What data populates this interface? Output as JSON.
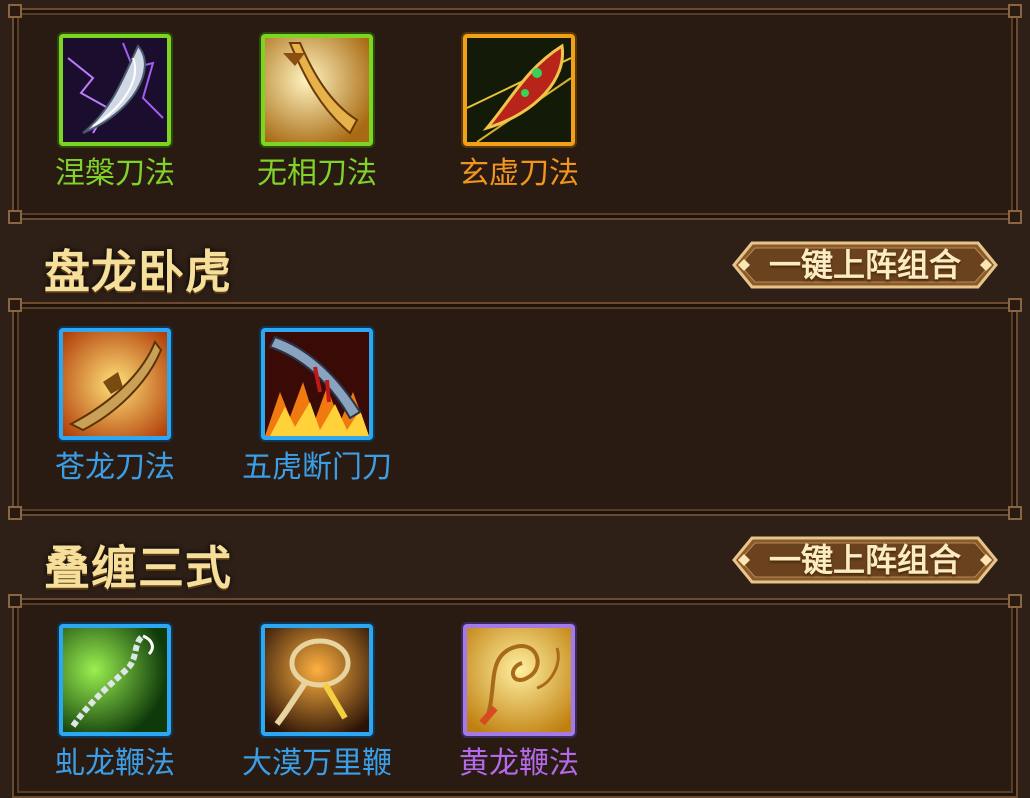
{
  "groups": [
    {
      "skills": [
        {
          "name": "涅槃刀法",
          "rarity": "green",
          "icon": "purple-lightning-blade-icon"
        },
        {
          "name": "无相刀法",
          "rarity": "green",
          "icon": "golden-sabre-icon"
        },
        {
          "name": "玄虚刀法",
          "rarity": "orange",
          "icon": "ornate-red-blade-icon"
        }
      ]
    },
    {
      "title": "盘龙卧虎",
      "deploy_label": "一键上阵组合",
      "skills": [
        {
          "name": "苍龙刀法",
          "rarity": "blue",
          "icon": "flaming-dragon-blade-icon"
        },
        {
          "name": "五虎断门刀",
          "rarity": "blue",
          "icon": "bloody-fire-blade-icon"
        }
      ]
    },
    {
      "title": "叠缠三式",
      "deploy_label": "一键上阵组合",
      "skills": [
        {
          "name": "虬龙鞭法",
          "rarity": "blue",
          "icon": "green-chain-whip-icon"
        },
        {
          "name": "大漠万里鞭",
          "rarity": "blue",
          "icon": "rope-whip-icon"
        },
        {
          "name": "黄龙鞭法",
          "rarity": "purple",
          "icon": "golden-whip-icon"
        }
      ]
    }
  ],
  "colors": {
    "green": "#7fd32a",
    "orange": "#f0951d",
    "blue": "#3a9fe8",
    "purple": "#b36ae8",
    "title": "#f6df9a",
    "background": "#2a1b12"
  }
}
